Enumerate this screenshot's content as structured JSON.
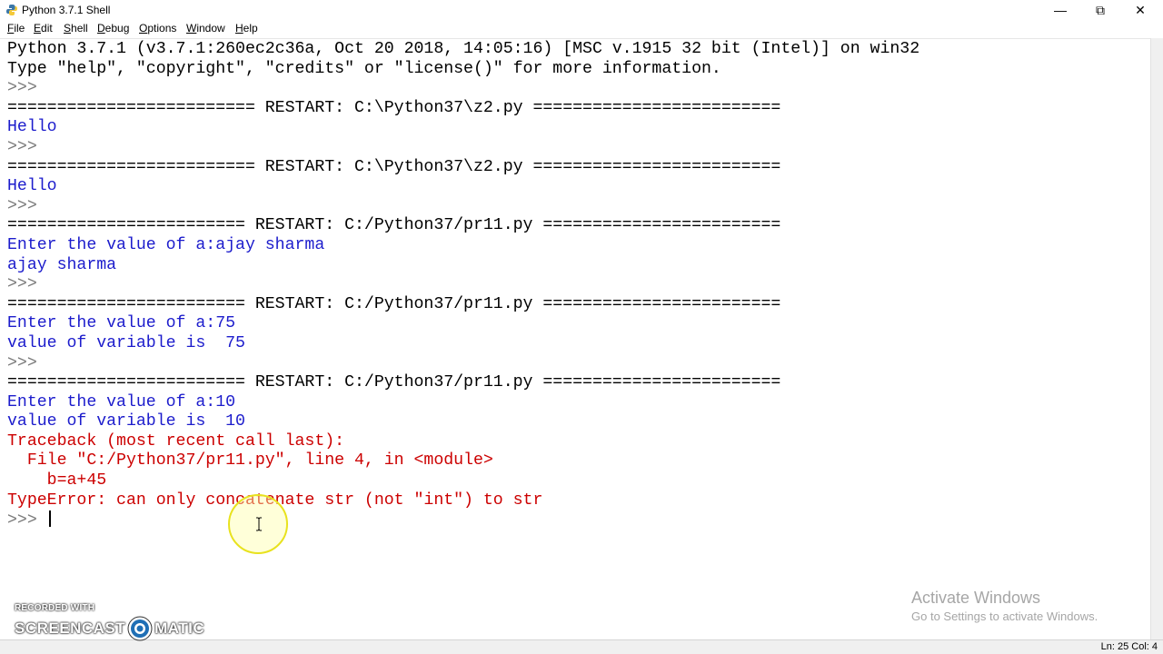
{
  "window": {
    "title": "Python 3.7.1 Shell",
    "controls": {
      "minimize": "—",
      "maximize": "⧉",
      "close": "✕"
    }
  },
  "menu": [
    {
      "label": "File",
      "accel": "F",
      "rest": "ile"
    },
    {
      "label": "Edit",
      "accel": "E",
      "rest": "dit"
    },
    {
      "label": "Shell",
      "accel": "S",
      "rest": "hell"
    },
    {
      "label": "Debug",
      "accel": "D",
      "rest": "ebug"
    },
    {
      "label": "Options",
      "accel": "O",
      "rest": "ptions"
    },
    {
      "label": "Window",
      "accel": "W",
      "rest": "indow"
    },
    {
      "label": "Help",
      "accel": "H",
      "rest": "elp"
    }
  ],
  "shell": {
    "lines": [
      {
        "kind": "std",
        "text": "Python 3.7.1 (v3.7.1:260ec2c36a, Oct 20 2018, 14:05:16) [MSC v.1915 32 bit (Intel)] on win32"
      },
      {
        "kind": "std",
        "text": "Type \"help\", \"copyright\", \"credits\" or \"license()\" for more information."
      },
      {
        "kind": "prm",
        "text": ">>> "
      },
      {
        "kind": "std",
        "text": "========================= RESTART: C:\\Python37\\z2.py ========================="
      },
      {
        "kind": "out",
        "text": "Hello"
      },
      {
        "kind": "prm",
        "text": ">>> "
      },
      {
        "kind": "std",
        "text": "========================= RESTART: C:\\Python37\\z2.py ========================="
      },
      {
        "kind": "out",
        "text": "Hello"
      },
      {
        "kind": "prm",
        "text": ">>> "
      },
      {
        "kind": "std",
        "text": "======================== RESTART: C:/Python37/pr11.py ========================"
      },
      {
        "kind": "out",
        "text": "Enter the value of a:ajay sharma"
      },
      {
        "kind": "out",
        "text": "ajay sharma"
      },
      {
        "kind": "prm",
        "text": ">>> "
      },
      {
        "kind": "std",
        "text": "======================== RESTART: C:/Python37/pr11.py ========================"
      },
      {
        "kind": "out",
        "text": "Enter the value of a:75"
      },
      {
        "kind": "out",
        "text": "value of variable is  75"
      },
      {
        "kind": "prm",
        "text": ">>> "
      },
      {
        "kind": "std",
        "text": "======================== RESTART: C:/Python37/pr11.py ========================"
      },
      {
        "kind": "out",
        "text": "Enter the value of a:10"
      },
      {
        "kind": "out",
        "text": "value of variable is  10"
      },
      {
        "kind": "err",
        "text": "Traceback (most recent call last):"
      },
      {
        "kind": "err",
        "text": "  File \"C:/Python37/pr11.py\", line 4, in <module>"
      },
      {
        "kind": "err",
        "text": "    b=a+45"
      },
      {
        "kind": "err",
        "text": "TypeError: can only concatenate str (not \"int\") to str"
      }
    ],
    "prompt": ">>> "
  },
  "status": {
    "text": "Ln: 25   Col: 4"
  },
  "activation": {
    "title": "Activate Windows",
    "subtitle": "Go to Settings to activate Windows."
  },
  "watermark": {
    "top": "RECORDED WITH",
    "left": "SCREENCAST",
    "right": "MATIC"
  },
  "colors": {
    "output": "#1c1ccc",
    "error": "#cc0000",
    "standard": "#000000",
    "prompt": "#7a7a7a",
    "halo": "#e8e21e"
  }
}
